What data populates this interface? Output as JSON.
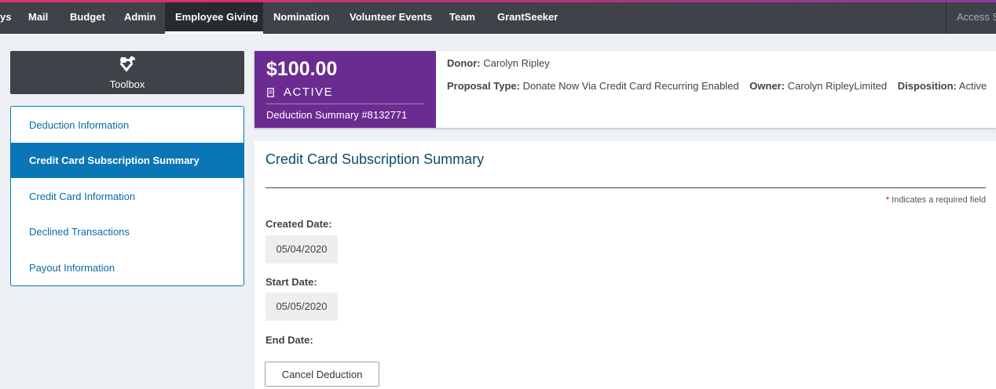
{
  "nav": {
    "partial_first": "ys",
    "items": [
      "Mail",
      "Budget",
      "Admin",
      "Employee Giving",
      "Nomination",
      "Volunteer Events",
      "Team",
      "GrantSeeker"
    ],
    "active": "Employee Giving",
    "access": "Access S"
  },
  "toolbox": {
    "label": "Toolbox",
    "icon": "tools-icon"
  },
  "sidenav": {
    "items": [
      "Deduction Information",
      "Credit Card Subscription Summary",
      "Credit Card Information",
      "Declined Transactions",
      "Payout Information"
    ],
    "active": "Credit Card Subscription Summary"
  },
  "summary": {
    "amount": "$100.00",
    "status": "ACTIVE",
    "deduction_summary": "Deduction Summary #8132771",
    "donor_label": "Donor:",
    "donor": "Carolyn Ripley",
    "proposal_type_label": "Proposal Type:",
    "proposal_type": "Donate Now Via Credit Card Recurring Enabled",
    "owner_label": "Owner:",
    "owner": "Carolyn RipleyLimited",
    "disposition_label": "Disposition:",
    "disposition": "Active"
  },
  "panel": {
    "title": "Credit Card Subscription Summary",
    "required_star": "*",
    "required_note": "Indicates a required field",
    "created_label": "Created Date:",
    "created_value": "05/04/2020",
    "start_label": "Start Date:",
    "start_value": "05/05/2020",
    "end_label": "End Date:",
    "cancel_label": "Cancel Deduction"
  },
  "colors": {
    "nav_bg": "#3f4349",
    "accent_purple": "#6b2c91",
    "link_blue": "#0a76b7",
    "title_blue": "#0b4a6e"
  }
}
